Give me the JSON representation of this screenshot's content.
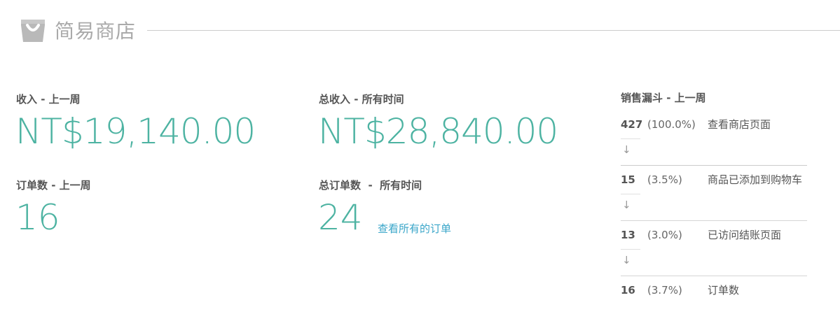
{
  "header": {
    "store_title": "简易商店",
    "logo_icon": "shopping-bag-icon"
  },
  "stats": {
    "revenue_last_week": {
      "label": "收入 - 上一周",
      "value": "NT$19,140.00"
    },
    "revenue_all_time": {
      "label": "总收入 - 所有时间",
      "value": "NT$28,840.00"
    },
    "orders_last_week": {
      "label": "订单数 - 上一周",
      "value": "16"
    },
    "orders_all_time": {
      "label": "总订单数  -  所有时间",
      "value": "24",
      "link": "查看所有的订单"
    }
  },
  "funnel": {
    "title": "销售漏斗 - 上一周",
    "arrow": "↓",
    "steps": [
      {
        "count": "427",
        "percent": "(100.0%)",
        "label": "查看商店页面"
      },
      {
        "count": "15",
        "percent": "(3.5%)",
        "label": "商品已添加到购物车"
      },
      {
        "count": "13",
        "percent": "(3.0%)",
        "label": "已访问结账页面"
      },
      {
        "count": "16",
        "percent": "(3.7%)",
        "label": "订单数"
      }
    ]
  },
  "colors": {
    "accent": "#4db3a2",
    "link": "#3aa6c9",
    "muted": "#aaaaaa"
  }
}
